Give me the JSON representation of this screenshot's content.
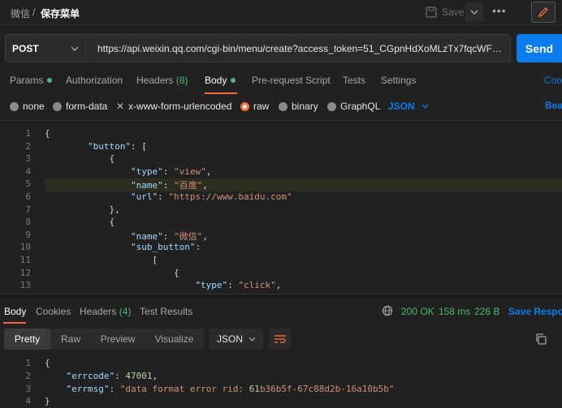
{
  "breadcrumb": {
    "parent": "微信",
    "separator": "/",
    "current": "保存菜单"
  },
  "toolbar": {
    "save_label": "Save",
    "more_label": "•••"
  },
  "request": {
    "method": "POST",
    "url": "https://api.weixin.qq.com/cgi-bin/menu/create?access_token=51_CGpnHdXoMLzTx7fqcWFSf0NAI…",
    "send_label": "Send"
  },
  "request_tabs": [
    {
      "label": "Params",
      "dot": true
    },
    {
      "label": "Authorization"
    },
    {
      "label": "Headers",
      "count": "(8)"
    },
    {
      "label": "Body",
      "dot": true,
      "active": true
    },
    {
      "label": "Pre-request Script"
    },
    {
      "label": "Tests"
    },
    {
      "label": "Settings"
    }
  ],
  "request_tabs_right": "Coo",
  "body_types": [
    {
      "label": "none"
    },
    {
      "label": "form-data"
    },
    {
      "label": "x-www-form-urlencoded"
    },
    {
      "label": "raw",
      "selected": true
    },
    {
      "label": "binary"
    },
    {
      "label": "GraphQL"
    }
  ],
  "body_format": "JSON",
  "body_types_right": "Beau",
  "editor": {
    "line_numbers": [
      "1",
      "2",
      "3",
      "4",
      "5",
      "6",
      "7",
      "8",
      "9",
      "10",
      "11",
      "12",
      "13"
    ],
    "lines": [
      "{",
      "        \"button\": [",
      "            {",
      "                \"type\": \"view\",",
      "                \"name\": \"百度\",",
      "                \"url\": \"https://www.baidu.com\"",
      "            },",
      "            {",
      "                \"name\": \"微信\",",
      "                \"sub_button\":",
      "                    [",
      "                        {",
      "                            \"type\": \"click\","
    ]
  },
  "response_tabs": [
    {
      "label": "Body",
      "active": true
    },
    {
      "label": "Cookies"
    },
    {
      "label": "Headers",
      "count": "(4)"
    },
    {
      "label": "Test Results"
    }
  ],
  "response_status": {
    "status": "200 OK",
    "time": "158 ms",
    "size": "226 B",
    "save_label": "Save Respon"
  },
  "response_views": [
    "Pretty",
    "Raw",
    "Preview",
    "Visualize"
  ],
  "response_format": "JSON",
  "response": {
    "line_numbers": [
      "1",
      "2",
      "3",
      "4"
    ],
    "lines": [
      "{",
      "    \"errcode\": 47001,",
      "    \"errmsg\": \"data format error rid: 61b36b5f-67c88d2b-16a10b5b\"",
      "}"
    ]
  },
  "colors": {
    "accent": "#F26B3A",
    "send": "#097BED",
    "success": "#49B87A"
  }
}
